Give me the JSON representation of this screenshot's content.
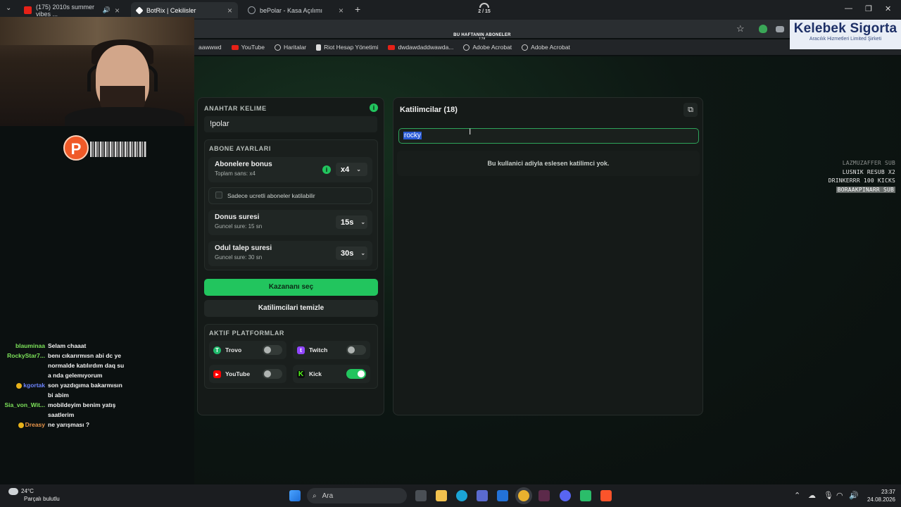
{
  "browser": {
    "tabs": [
      {
        "label": "(175) 2010s summer vibes ...",
        "fav": "#e62117"
      },
      {
        "label": "BotRix | Cekilisler",
        "fav": "#ffffff"
      },
      {
        "label": "bePolar - Kasa Açılımı",
        "fav": "#9aa0a6"
      }
    ],
    "progress_text": "2 / 15",
    "weekly_title": "BU HAFTANIN ABONELER",
    "weekly_sub": "178",
    "bookmarks": [
      "aawwwd",
      "YouTube",
      "Haritalar",
      "Riot Hesap Yönetimi",
      "dwdawdaddwawda...",
      "Adobe Acrobat",
      "Adobe Acrobat"
    ]
  },
  "sponsor": {
    "name": "Kelebek Sigorta",
    "tagline": "Aracılık Hizmetleri Limited Şirketi"
  },
  "left_panel": {
    "keyword_title": "ANAHTAR KELIME",
    "keyword_value": "!polar",
    "sub_title": "ABONE AYARLARI",
    "bonus": {
      "title": "Abonelere bonus",
      "sub": "Toplam sans: x4",
      "value": "x4"
    },
    "paid_only": "Sadece ucretli aboneler katilabilir",
    "bonus_time": {
      "title": "Donus suresi",
      "sub": "Guncel sure: 15 sn",
      "value": "15s"
    },
    "claim_time": {
      "title": "Odul talep suresi",
      "sub": "Guncel sure: 30 sn",
      "value": "30s"
    },
    "pick_winner": "Kazananı seç",
    "clear_participants": "Katilimcilari temizle",
    "platforms_title": "AKTIF PLATFORMLAR",
    "platforms": [
      {
        "name": "Trovo",
        "enabled": false,
        "color": "#1fb96b"
      },
      {
        "name": "Twitch",
        "enabled": false,
        "color": "#9146ff"
      },
      {
        "name": "YouTube",
        "enabled": false,
        "color": "#ff0000"
      },
      {
        "name": "Kick",
        "enabled": true,
        "color": "#53fc18"
      }
    ]
  },
  "right_panel": {
    "title": "Katilimcilar (18)",
    "search_value": "rocky",
    "empty_text": "Bu kullanici adiyla eslesen katilimci yok."
  },
  "events": [
    "LAZMUZAFFER SUB",
    "LUSNIK RESUB X2",
    "DRINKERRR 100 KICKS",
    "BORAAKPINARR SUB"
  ],
  "chat": [
    {
      "user": "blauminaa",
      "color": "#7de35a",
      "text": "Selam chaaat"
    },
    {
      "user": "RockyStar7...",
      "color": "#7de35a",
      "text": "benı cıkarırmısn abi dc ye normalde katılırdım daq su a nda gelemıyorum"
    },
    {
      "user": "kgortak",
      "color": "#6d84ff",
      "text": "son yazdıgıma bakarmısın bi abim"
    },
    {
      "user": "Sia_von_Wit...",
      "color": "#7de35a",
      "text": "mobildeyim benim yatış saatlerim"
    },
    {
      "user": "Dreasy",
      "color": "#e8954a",
      "text": "ne yarışması ?"
    }
  ],
  "taskbar": {
    "temp": "24°C",
    "weather": "Parçalı bulutlu",
    "search_placeholder": "Ara",
    "time": "23:37",
    "date": "24.08.2026"
  }
}
